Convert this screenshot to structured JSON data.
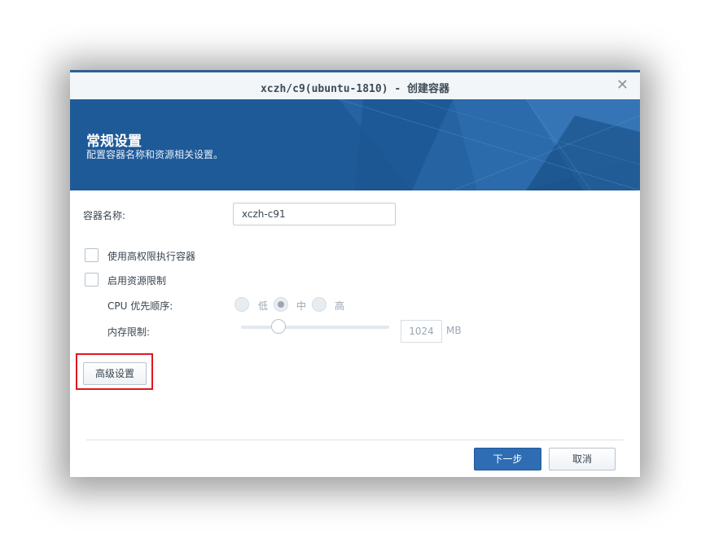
{
  "window": {
    "title": "xczh/c9(ubuntu-1810) - 创建容器",
    "close_glyph": "✕"
  },
  "banner": {
    "title": "常规设置",
    "subtitle": "配置容器名称和资源相关设置。"
  },
  "form": {
    "container_name_label": "容器名称:",
    "container_name_value": "xczh-c91",
    "privileged_label": "使用高权限执行容器",
    "privileged_checked": false,
    "resource_limit_label": "启用资源限制",
    "resource_limit_checked": false,
    "cpu_priority_label": "CPU 优先顺序:",
    "cpu_options": [
      "低",
      "中",
      "高"
    ],
    "cpu_selected": "中",
    "memory_limit_label": "内存限制:",
    "memory_value": "1024",
    "memory_unit": "MB"
  },
  "buttons": {
    "advanced": "高级设置",
    "next": "下一步",
    "cancel": "取消"
  },
  "colors": {
    "accent": "#2e6db3",
    "banner": "#1f5a98",
    "highlight": "#e0161e"
  }
}
